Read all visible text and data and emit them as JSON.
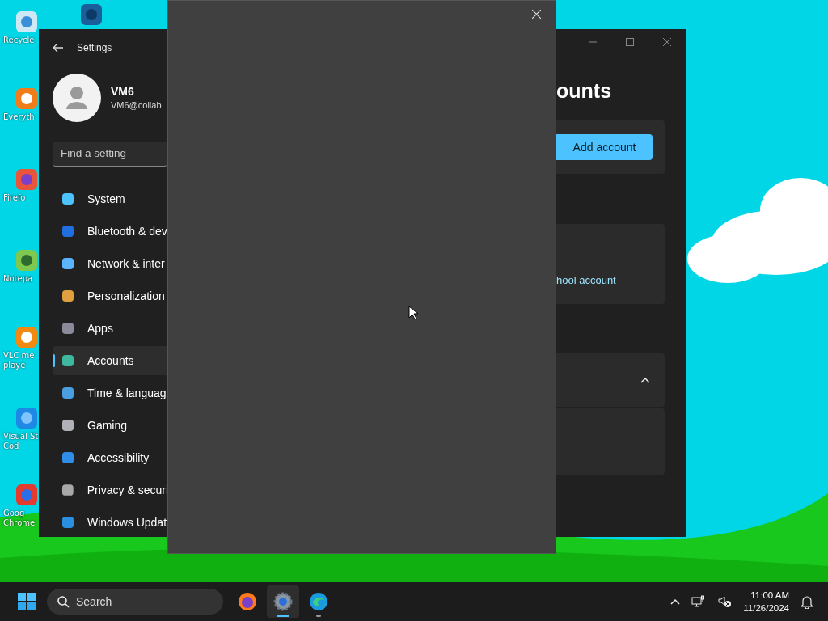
{
  "desktop": {
    "icons": [
      {
        "lines": [
          "Recycle"
        ]
      },
      {
        "lines": [
          "Everyth"
        ]
      },
      {
        "lines": [
          "Firefo"
        ]
      },
      {
        "lines": [
          "Notepa"
        ]
      },
      {
        "lines": [
          "VLC me",
          "playe"
        ]
      },
      {
        "lines": [
          "Visual St",
          "Cod"
        ]
      },
      {
        "lines": [
          "Goog",
          "Chrome"
        ]
      }
    ]
  },
  "settings": {
    "title": "Settings",
    "user": {
      "name": "VM6",
      "email": "VM6@collab"
    },
    "search": {
      "placeholder": "Find a setting"
    },
    "nav": [
      {
        "label": "System",
        "selected": false
      },
      {
        "label": "Bluetooth & dev",
        "selected": false
      },
      {
        "label": "Network & inter",
        "selected": false
      },
      {
        "label": "Personalization",
        "selected": false
      },
      {
        "label": "Apps",
        "selected": false
      },
      {
        "label": "Accounts",
        "selected": true
      },
      {
        "label": "Time & languag",
        "selected": false
      },
      {
        "label": "Gaming",
        "selected": false
      },
      {
        "label": "Accessibility",
        "selected": false
      },
      {
        "label": "Privacy & securi",
        "selected": false
      },
      {
        "label": "Windows Updat",
        "selected": false
      }
    ],
    "page_title": "ounts",
    "add_button": "Add account",
    "link": "hool account",
    "section": {
      "expanded": true
    }
  },
  "taskbar": {
    "search": {
      "placeholder": "Search"
    },
    "apps": [
      {
        "selected": false,
        "running": false
      },
      {
        "selected": true,
        "running": true
      },
      {
        "selected": false,
        "running": true
      }
    ],
    "time": "11:00 AM",
    "date": "11/26/2024"
  }
}
